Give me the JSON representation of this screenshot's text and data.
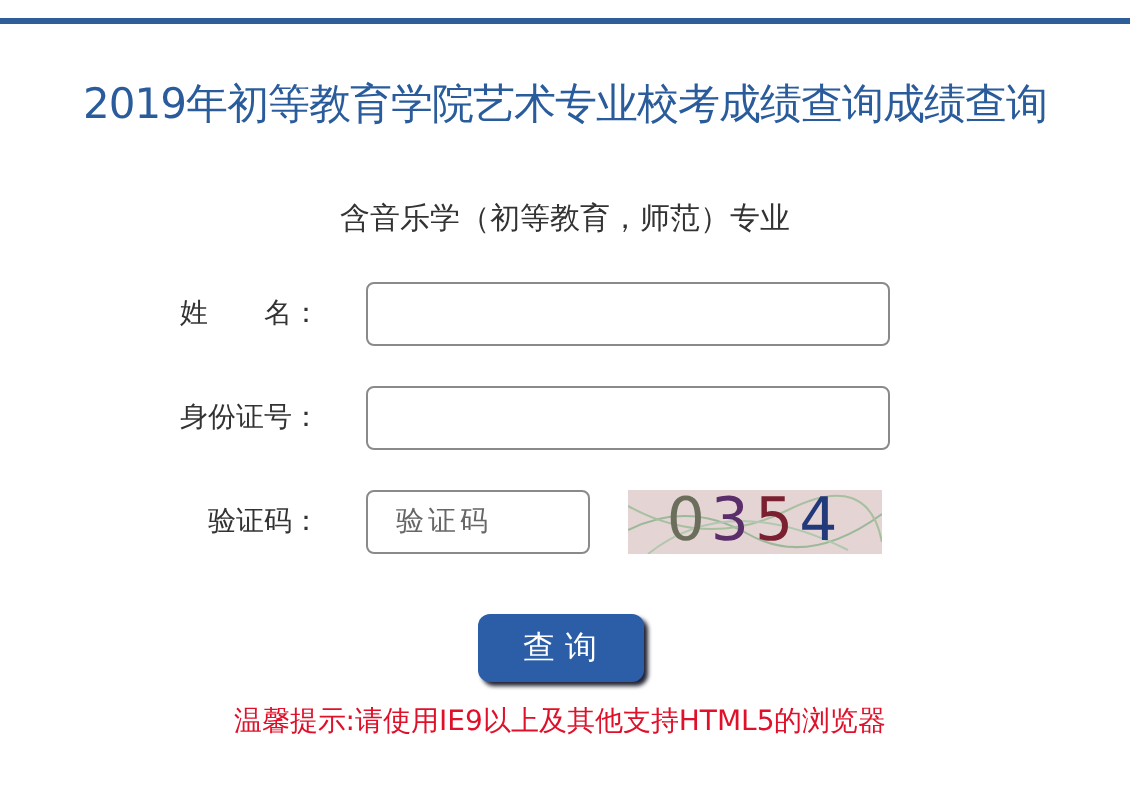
{
  "title": "2019年初等教育学院艺术专业校考成绩查询成绩查询",
  "subtitle": "含音乐学（初等教育，师范）专业",
  "fields": [
    {
      "kind": "text",
      "label": "姓　　名："
    },
    {
      "kind": "text",
      "label": "身份证号："
    },
    {
      "kind": "captcha",
      "label": "验证码：",
      "placeholder": "验证码",
      "captcha": "0354"
    }
  ],
  "button": "查 询",
  "notice": "温馨提示:请使用IE9以上及其他支持HTML5的浏览器"
}
